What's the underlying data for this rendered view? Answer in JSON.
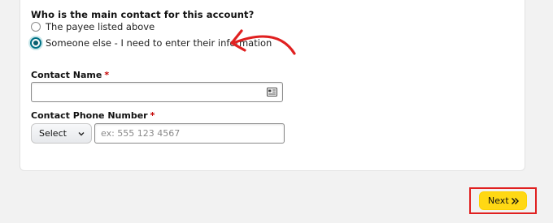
{
  "form": {
    "question": "Who is the main contact for this account?",
    "options": [
      {
        "label": "The payee listed above",
        "selected": false
      },
      {
        "label": "Someone else - I need to enter their information",
        "selected": true
      }
    ],
    "contact_name": {
      "label": "Contact Name",
      "required_mark": "*",
      "value": "",
      "icon": "contact-card-icon"
    },
    "contact_phone": {
      "label": "Contact Phone Number",
      "required_mark": "*",
      "country_select": "Select",
      "placeholder": "ex: 555 123 4567"
    }
  },
  "footer": {
    "next_label": "Next",
    "next_icon": "double-chevron-right-icon"
  },
  "annotation": {
    "color": "#e02020"
  },
  "colors": {
    "accent": "#007185",
    "button": "#ffd814",
    "required": "#c40000"
  }
}
